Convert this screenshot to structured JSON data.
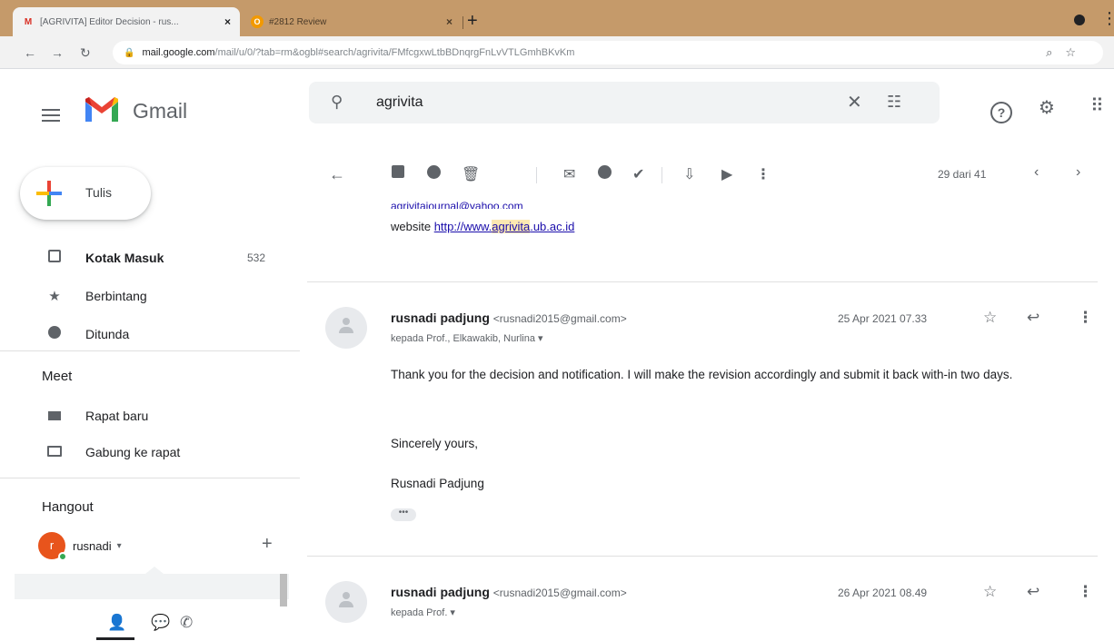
{
  "browser": {
    "tabs": [
      {
        "title": "[AGRIVITA] Editor Decision - rus...",
        "close": "×",
        "active": true,
        "favicon": "M"
      },
      {
        "title": "#2812 Review",
        "close": "×",
        "active": false,
        "favicon": "O"
      }
    ],
    "new_tab": "+",
    "url_host": "mail.google.com",
    "url_path": "/mail/u/0/?tab=rm&ogbl#search/agrivita/FMfcgxwLtbBDnqrgFnLvVTLGmhBKvKm"
  },
  "gmail": {
    "wordmark": "Gmail",
    "search_value": "agrivita"
  },
  "sidebar": {
    "compose_label": "Tulis",
    "items": [
      {
        "label": "Kotak Masuk",
        "count": "532",
        "icon": "inbox-icon",
        "bold": true
      },
      {
        "label": "Berbintang",
        "count": "",
        "icon": "star-icon",
        "bold": false
      },
      {
        "label": "Ditunda",
        "count": "",
        "icon": "clock-icon",
        "bold": false
      }
    ],
    "meet_heading": "Meet",
    "meet_items": [
      {
        "label": "Rapat baru",
        "icon": "video-icon"
      },
      {
        "label": "Gabung ke rapat",
        "icon": "keyboard-icon"
      }
    ],
    "hangout_heading": "Hangout",
    "hangout_user": "rusnadi",
    "hangout_user_initial": "r",
    "hangout_caret": "▾",
    "hangout_add": "+"
  },
  "toolbar": {
    "pager_text": "29 dari 41"
  },
  "thread": {
    "prev_signature_email": "agrivitajournal@yahoo.com",
    "prev_signature_website_prefix": "website ",
    "prev_signature_link_a": "http://www.",
    "prev_signature_link_hl": "agrivita",
    "prev_signature_link_b": ".ub.ac.id",
    "messages": [
      {
        "sender_name": "rusnadi padjung",
        "sender_email": "<rusnadi2015@gmail.com>",
        "recipients": "kepada Prof., Elkawakib, Nurlina ▾",
        "date": "25 Apr 2021 07.33",
        "body": [
          "Thank you for the decision and notification. I will make the revision accordingly and submit it back with-in two days.",
          "Sincerely yours,",
          "Rusnadi Padjung"
        ],
        "trimmed": "•••"
      },
      {
        "sender_name": "rusnadi padjung",
        "sender_email": "<rusnadi2015@gmail.com>",
        "recipients": "kepada Prof. ▾",
        "date": "26 Apr 2021 08.49"
      }
    ]
  },
  "colors": {
    "tabbar": "#c59a6a",
    "gmail_red": "#ea4335",
    "link_blue": "#1a0dab",
    "highlight": "#fce8b2"
  }
}
